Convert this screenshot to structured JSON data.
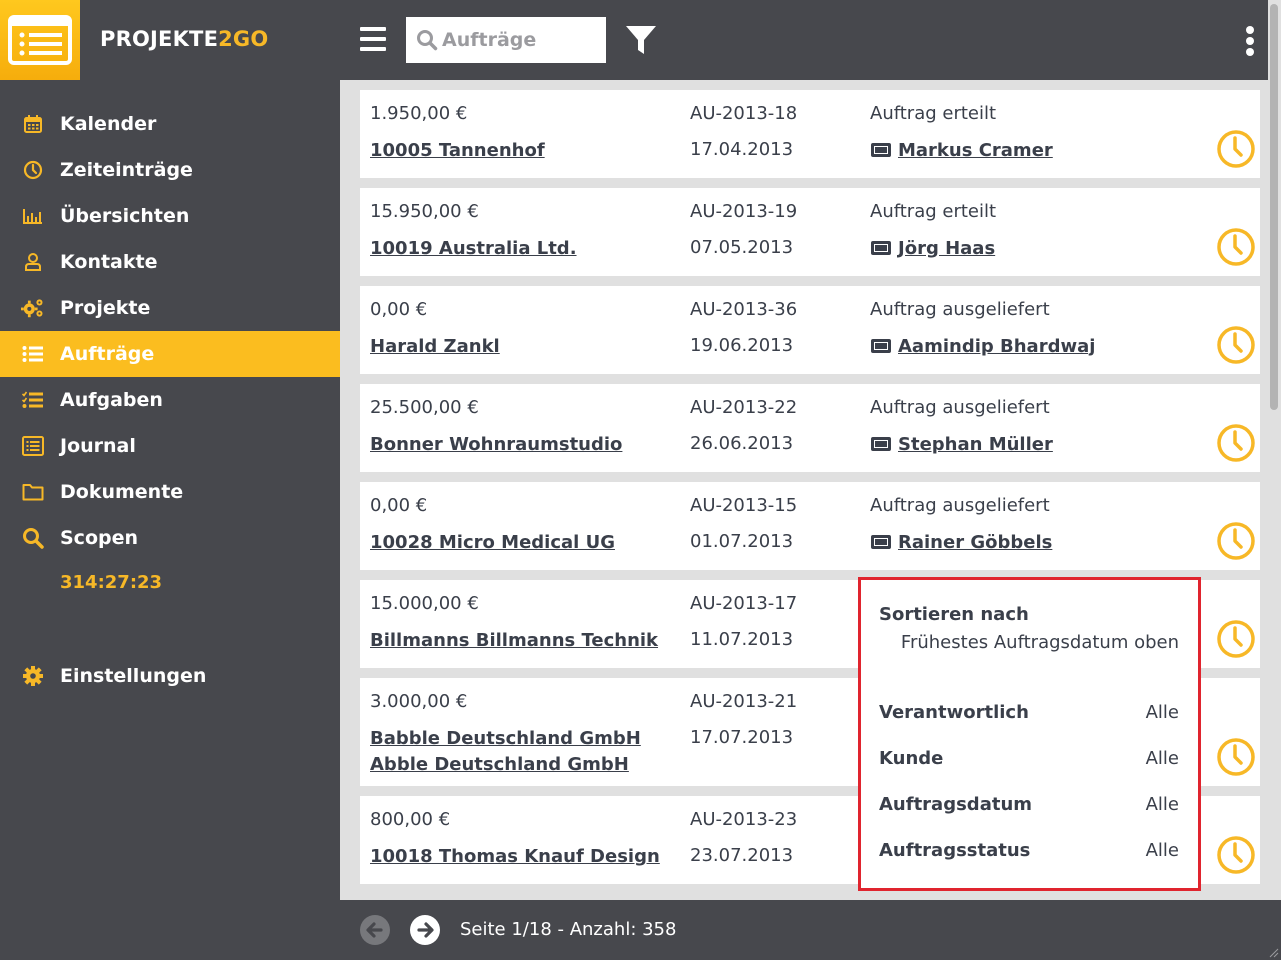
{
  "brand": {
    "name_main": "PROJEKTE",
    "name_accent": "2GO"
  },
  "colors": {
    "accent": "#fbbd1f",
    "dark": "#47484d",
    "text": "#3a3f4a",
    "highlight_border": "#e0242e",
    "background": "#e0e0e0"
  },
  "sidebar": {
    "items": [
      {
        "label": "Kalender",
        "icon": "calendar-icon",
        "active": false
      },
      {
        "label": "Zeiteinträge",
        "icon": "clock-icon",
        "active": false
      },
      {
        "label": "Übersichten",
        "icon": "bar-chart-icon",
        "active": false
      },
      {
        "label": "Kontakte",
        "icon": "user-icon",
        "active": false
      },
      {
        "label": "Projekte",
        "icon": "gears-icon",
        "active": false
      },
      {
        "label": "Aufträge",
        "icon": "list-icon",
        "active": true
      },
      {
        "label": "Aufgaben",
        "icon": "task-list-icon",
        "active": false
      },
      {
        "label": "Journal",
        "icon": "journal-icon",
        "active": false
      },
      {
        "label": "Dokumente",
        "icon": "folder-icon",
        "active": false
      },
      {
        "label": "Scopen",
        "icon": "search-icon",
        "active": false
      }
    ],
    "timer": "314:27:23",
    "settings_label": "Einstellungen"
  },
  "topbar": {
    "search_placeholder": "Aufträge",
    "search_value": ""
  },
  "orders": [
    {
      "amount": "1.950,00 €",
      "number": "AU-2013-18",
      "status": "Auftrag erteilt",
      "customer": [
        "10005 Tannenhof"
      ],
      "date": "17.04.2013",
      "responsible": "Markus Cramer"
    },
    {
      "amount": "15.950,00 €",
      "number": "AU-2013-19",
      "status": "Auftrag erteilt",
      "customer": [
        "10019 Australia Ltd."
      ],
      "date": "07.05.2013",
      "responsible": "Jörg Haas"
    },
    {
      "amount": "0,00 €",
      "number": "AU-2013-36",
      "status": "Auftrag ausgeliefert",
      "customer": [
        "Harald Zankl"
      ],
      "date": "19.06.2013",
      "responsible": "Aamindip Bhardwaj"
    },
    {
      "amount": "25.500,00 €",
      "number": "AU-2013-22",
      "status": "Auftrag ausgeliefert",
      "customer": [
        "Bonner Wohnraumstudio"
      ],
      "date": "26.06.2013",
      "responsible": "Stephan Müller"
    },
    {
      "amount": "0,00 €",
      "number": "AU-2013-15",
      "status": "Auftrag ausgeliefert",
      "customer": [
        "10028 Micro Medical UG"
      ],
      "date": "01.07.2013",
      "responsible": "Rainer Göbbels"
    },
    {
      "amount": "15.000,00 €",
      "number": "AU-2013-17",
      "status": "",
      "customer": [
        "Billmanns Billmanns Technik"
      ],
      "date": "11.07.2013",
      "responsible": ""
    },
    {
      "amount": "3.000,00 €",
      "number": "AU-2013-21",
      "status": "",
      "customer": [
        "Babble Deutschland GmbH",
        "Abble Deutschland GmbH"
      ],
      "date": "17.07.2013",
      "responsible": ""
    },
    {
      "amount": "800,00 €",
      "number": "AU-2013-23",
      "status": "",
      "customer": [
        "10018 Thomas Knauf Design"
      ],
      "date": "23.07.2013",
      "responsible": ""
    }
  ],
  "filter_popup": {
    "sort_label": "Sortieren nach",
    "sort_value": "Frühestes Auftragsdatum oben",
    "filters": [
      {
        "label": "Verantwortlich",
        "value": "Alle"
      },
      {
        "label": "Kunde",
        "value": "Alle"
      },
      {
        "label": "Auftragsdatum",
        "value": "Alle"
      },
      {
        "label": "Auftragsstatus",
        "value": "Alle"
      }
    ]
  },
  "footer": {
    "page_info": "Seite 1/18 - Anzahl: 358",
    "prev_enabled": false,
    "next_enabled": true
  }
}
